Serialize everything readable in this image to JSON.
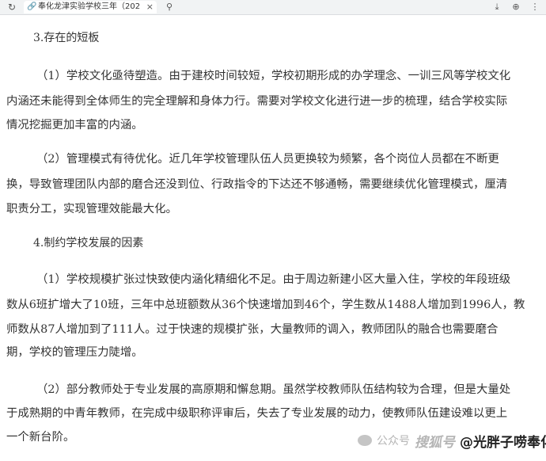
{
  "browser": {
    "tab_title": "奉化龙津实验学校三年（202",
    "close_glyph": "×",
    "reload_glyph": "↻",
    "search_glyph": "⚲",
    "right_icons": [
      "⤓",
      "⊕",
      "⋮"
    ]
  },
  "article": {
    "heading3": "3.存在的短板",
    "p1": [
      "（1）学校文化亟待塑造。由于建校时间较短，学校初期形成的办学理念、一训三风等学校文化",
      "内涵还未能得到全体师生的完全理解和身体力行。需要对学校文化进行进一步的梳理，结合学校实际",
      "情况挖掘更加丰富的内涵。"
    ],
    "p2": [
      "（2）管理模式有待优化。近几年学校管理队伍人员更换较为频繁，各个岗位人员都在不断更",
      "换，导致管理团队内部的磨合还没到位、行政指令的下达还不够通畅，需要继续优化管理模式，厘清",
      "职责分工，实现管理效能最大化。"
    ],
    "heading4": "4.制约学校发展的因素",
    "p3": [
      "（1）学校规模扩张过快致使内涵化精细化不足。由于周边新建小区大量入住，学校的年段班级",
      "数从6班扩增大了10班，三年中总班额数从36个快速增加到46个，学生数从1488人增加到1996人，教",
      "师数从87人增加到了111人。过于快速的规模扩张，大量教师的调入，教师团队的融合也需要磨合",
      "期，学校的管理压力陡增。"
    ],
    "p4": [
      "（2）部分教师处于专业发展的高原期和懈怠期。虽然学校教师队伍结构较为合理，但是大量处",
      "于成熟期的中青年教师，在完成中级职称评审后，失去了专业发展的动力，使教师队伍建设难以更上",
      "一个新台阶。"
    ]
  },
  "watermark": {
    "platform": "公众号",
    "handle": "搜狐号",
    "name": "@光胖子唠奉化"
  }
}
